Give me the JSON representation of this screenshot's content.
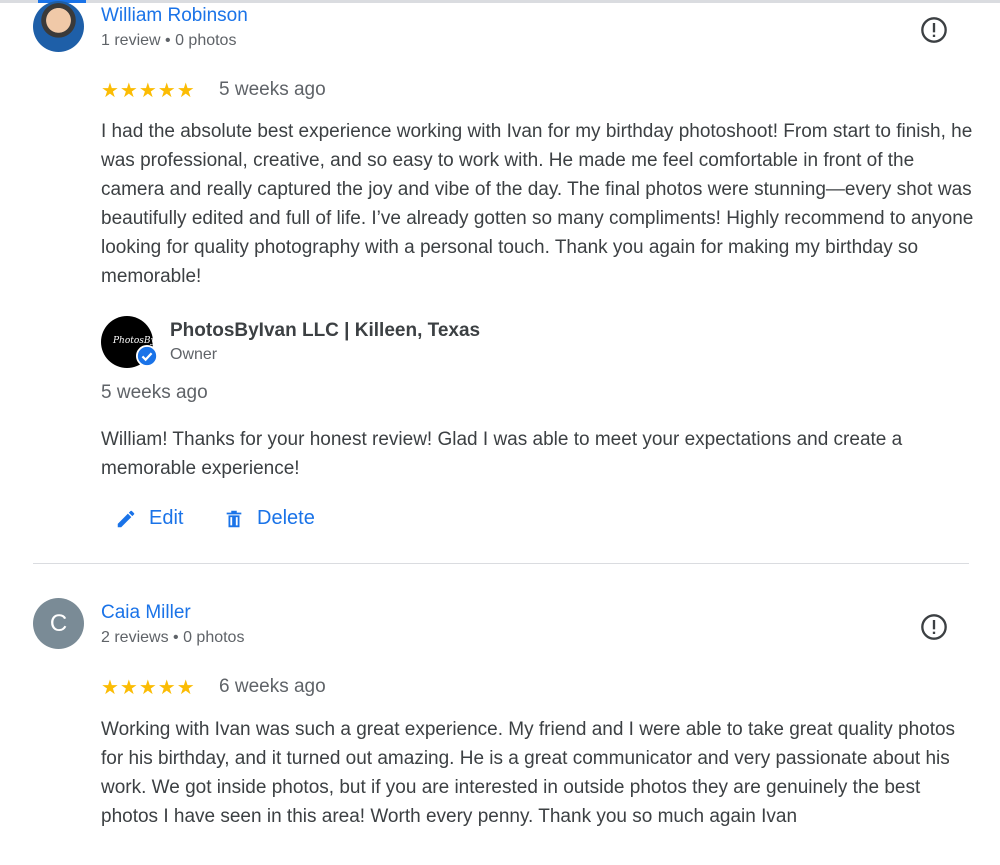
{
  "reviews": [
    {
      "author": "William Robinson",
      "meta": "1 review • 0 photos",
      "stars": "★★★★★",
      "date": "5 weeks ago",
      "text": "I had the absolute best experience working with Ivan for my birthday photoshoot! From start to finish, he was professional, creative, and so easy to work with. He made me feel comfortable in front of the camera and really captured the joy and vibe of the day. The final photos were stunning—every shot was beautifully edited and full of life. I’ve already gotten so many compliments! Highly recommend to anyone looking for quality photography with a personal touch. Thank you again for making my birthday so memorable!",
      "reply": {
        "owner_name": "PhotosByIvan LLC | Killeen, Texas",
        "owner_role": "Owner",
        "date": "5 weeks ago",
        "text": "William! Thanks for your honest review! Glad I was able to meet your expectations and create a memorable experience!"
      },
      "actions": {
        "edit": "Edit",
        "delete": "Delete"
      }
    },
    {
      "author": "Caia Miller",
      "avatar_letter": "C",
      "meta": "2 reviews • 0 photos",
      "stars": "★★★★★",
      "date": "6 weeks ago",
      "text": "Working with Ivan was such a great experience. My friend and I were able to take great quality photos for his birthday, and it turned out amazing. He is a great communicator and very passionate about his work. We got inside photos, but if you are interested in outside photos they are genuinely the best photos I have seen in this area! Worth every penny. Thank you so much again Ivan"
    }
  ],
  "icons": {
    "flag": "report-flag-icon",
    "edit": "pencil-icon",
    "delete": "trash-icon",
    "verified": "verified-badge-icon"
  },
  "colors": {
    "link": "#1a73e8",
    "star": "#fbbc04",
    "muted": "#5f6368",
    "text": "#3c4043"
  }
}
